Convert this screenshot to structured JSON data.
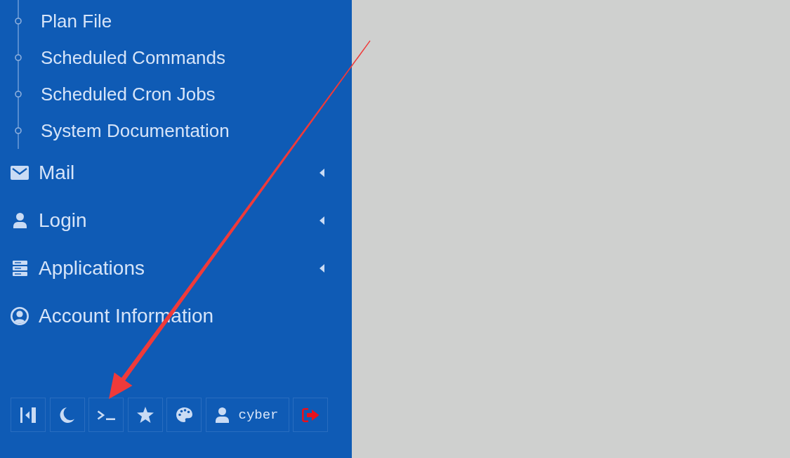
{
  "sidebar": {
    "submenu_items": [
      {
        "label": "Plan File"
      },
      {
        "label": "Scheduled Commands"
      },
      {
        "label": "Scheduled Cron Jobs"
      },
      {
        "label": "System Documentation"
      }
    ],
    "menu": [
      {
        "kind": "mail",
        "label": "Mail",
        "submenu": true
      },
      {
        "kind": "user",
        "label": "Login",
        "submenu": true
      },
      {
        "kind": "server",
        "label": "Applications",
        "submenu": true
      },
      {
        "kind": "account",
        "label": "Account Information",
        "submenu": false
      }
    ],
    "toolbar": [
      {
        "kind": "collapse"
      },
      {
        "kind": "theme"
      },
      {
        "kind": "terminal"
      },
      {
        "kind": "favorites"
      },
      {
        "kind": "palette"
      },
      {
        "kind": "user",
        "label": "cyber"
      },
      {
        "kind": "logout"
      }
    ]
  }
}
